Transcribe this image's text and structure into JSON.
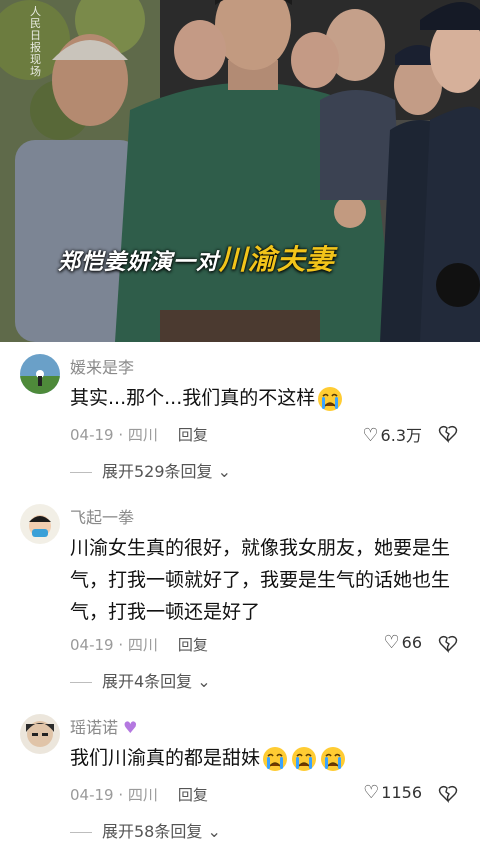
{
  "video": {
    "watermark": "人民日报现场",
    "caption_prefix": "郑恺姜妍演一对",
    "caption_highlight": "川渝夫妻"
  },
  "comments": [
    {
      "user": "媛来是李",
      "text": "其实...那个...我们真的不这样",
      "emoji_count": 1,
      "date": "04-19",
      "location": "四川",
      "reply_label": "回复",
      "likes": "6.3万",
      "expand": "展开529条回复"
    },
    {
      "user": "飞起一拳",
      "text": "川渝女生真的很好，就像我女朋友，她要是生气，打我一顿就好了，我要是生气的话她也生气，打我一顿还是好了",
      "emoji_count": 0,
      "date": "04-19",
      "location": "四川",
      "reply_label": "回复",
      "likes": "66",
      "expand": "展开4条回复"
    },
    {
      "user": "瑶诺诺",
      "text": "我们川渝真的都是甜妹",
      "emoji_count": 3,
      "date": "04-19",
      "location": "四川",
      "reply_label": "回复",
      "likes": "1156",
      "expand": "展开58条回复"
    }
  ],
  "icons": {
    "like": "heart-outline-icon",
    "dislike": "broken-heart-icon",
    "expand": "chevron-down-icon",
    "emoji": "crying-face-emoji"
  },
  "colors": {
    "caption_highlight": "#f2c41a",
    "username": "#8a8a8a",
    "meta": "#9a9a9a"
  }
}
